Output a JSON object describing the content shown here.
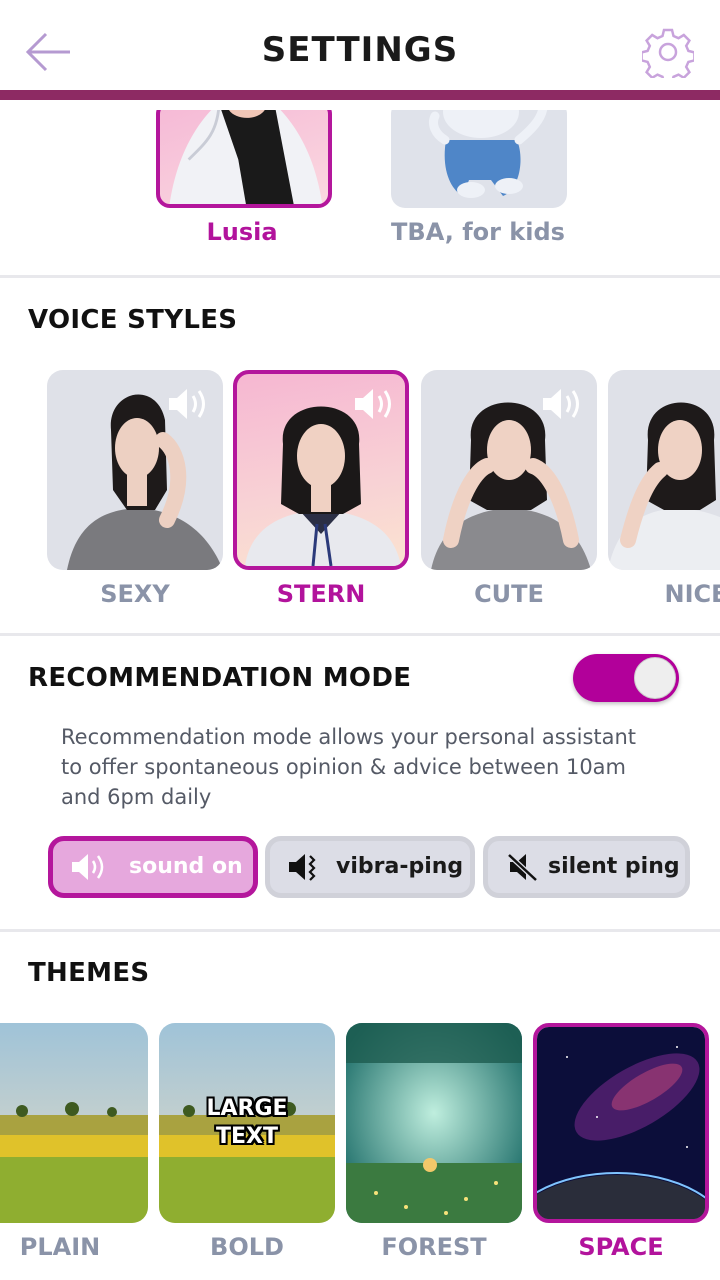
{
  "header": {
    "title": "SETTINGS",
    "back_icon": "back-arrow-icon",
    "settings_icon": "gear-icon",
    "accent_color": "#8d2a63"
  },
  "assistants": [
    {
      "label": "Lusia",
      "selected": true
    },
    {
      "label": "TBA, for kids",
      "selected": false
    }
  ],
  "voice_styles": {
    "title": "VOICE STYLES",
    "items": [
      {
        "label": "SEXY",
        "selected": false,
        "icon": "speaker-icon"
      },
      {
        "label": "STERN",
        "selected": true,
        "icon": "speaker-icon"
      },
      {
        "label": "CUTE",
        "selected": false,
        "icon": "speaker-icon"
      },
      {
        "label": "NICE",
        "selected": false,
        "icon": "speaker-icon"
      }
    ]
  },
  "recommendation": {
    "title": "RECOMMENDATION MODE",
    "toggle_on": true,
    "description": "Recommendation mode allows your personal assistant to offer spontaneous opinion & advice between 10am and 6pm daily",
    "ping_options": [
      {
        "label": "sound on",
        "icon": "speaker-icon",
        "selected": true
      },
      {
        "label": "vibra-ping",
        "icon": "vibrate-speaker-icon",
        "selected": false
      },
      {
        "label": "silent ping",
        "icon": "mute-icon",
        "selected": false
      }
    ]
  },
  "themes": {
    "title": "THEMES",
    "items": [
      {
        "label": "PLAIN",
        "selected": false
      },
      {
        "label": "BOLD",
        "selected": false,
        "overlay": "LARGE TEXT"
      },
      {
        "label": "FOREST",
        "selected": false
      },
      {
        "label": "SPACE",
        "selected": true
      }
    ]
  },
  "colors": {
    "selected": "#b2139c",
    "unselected_label": "#8a93a8"
  }
}
